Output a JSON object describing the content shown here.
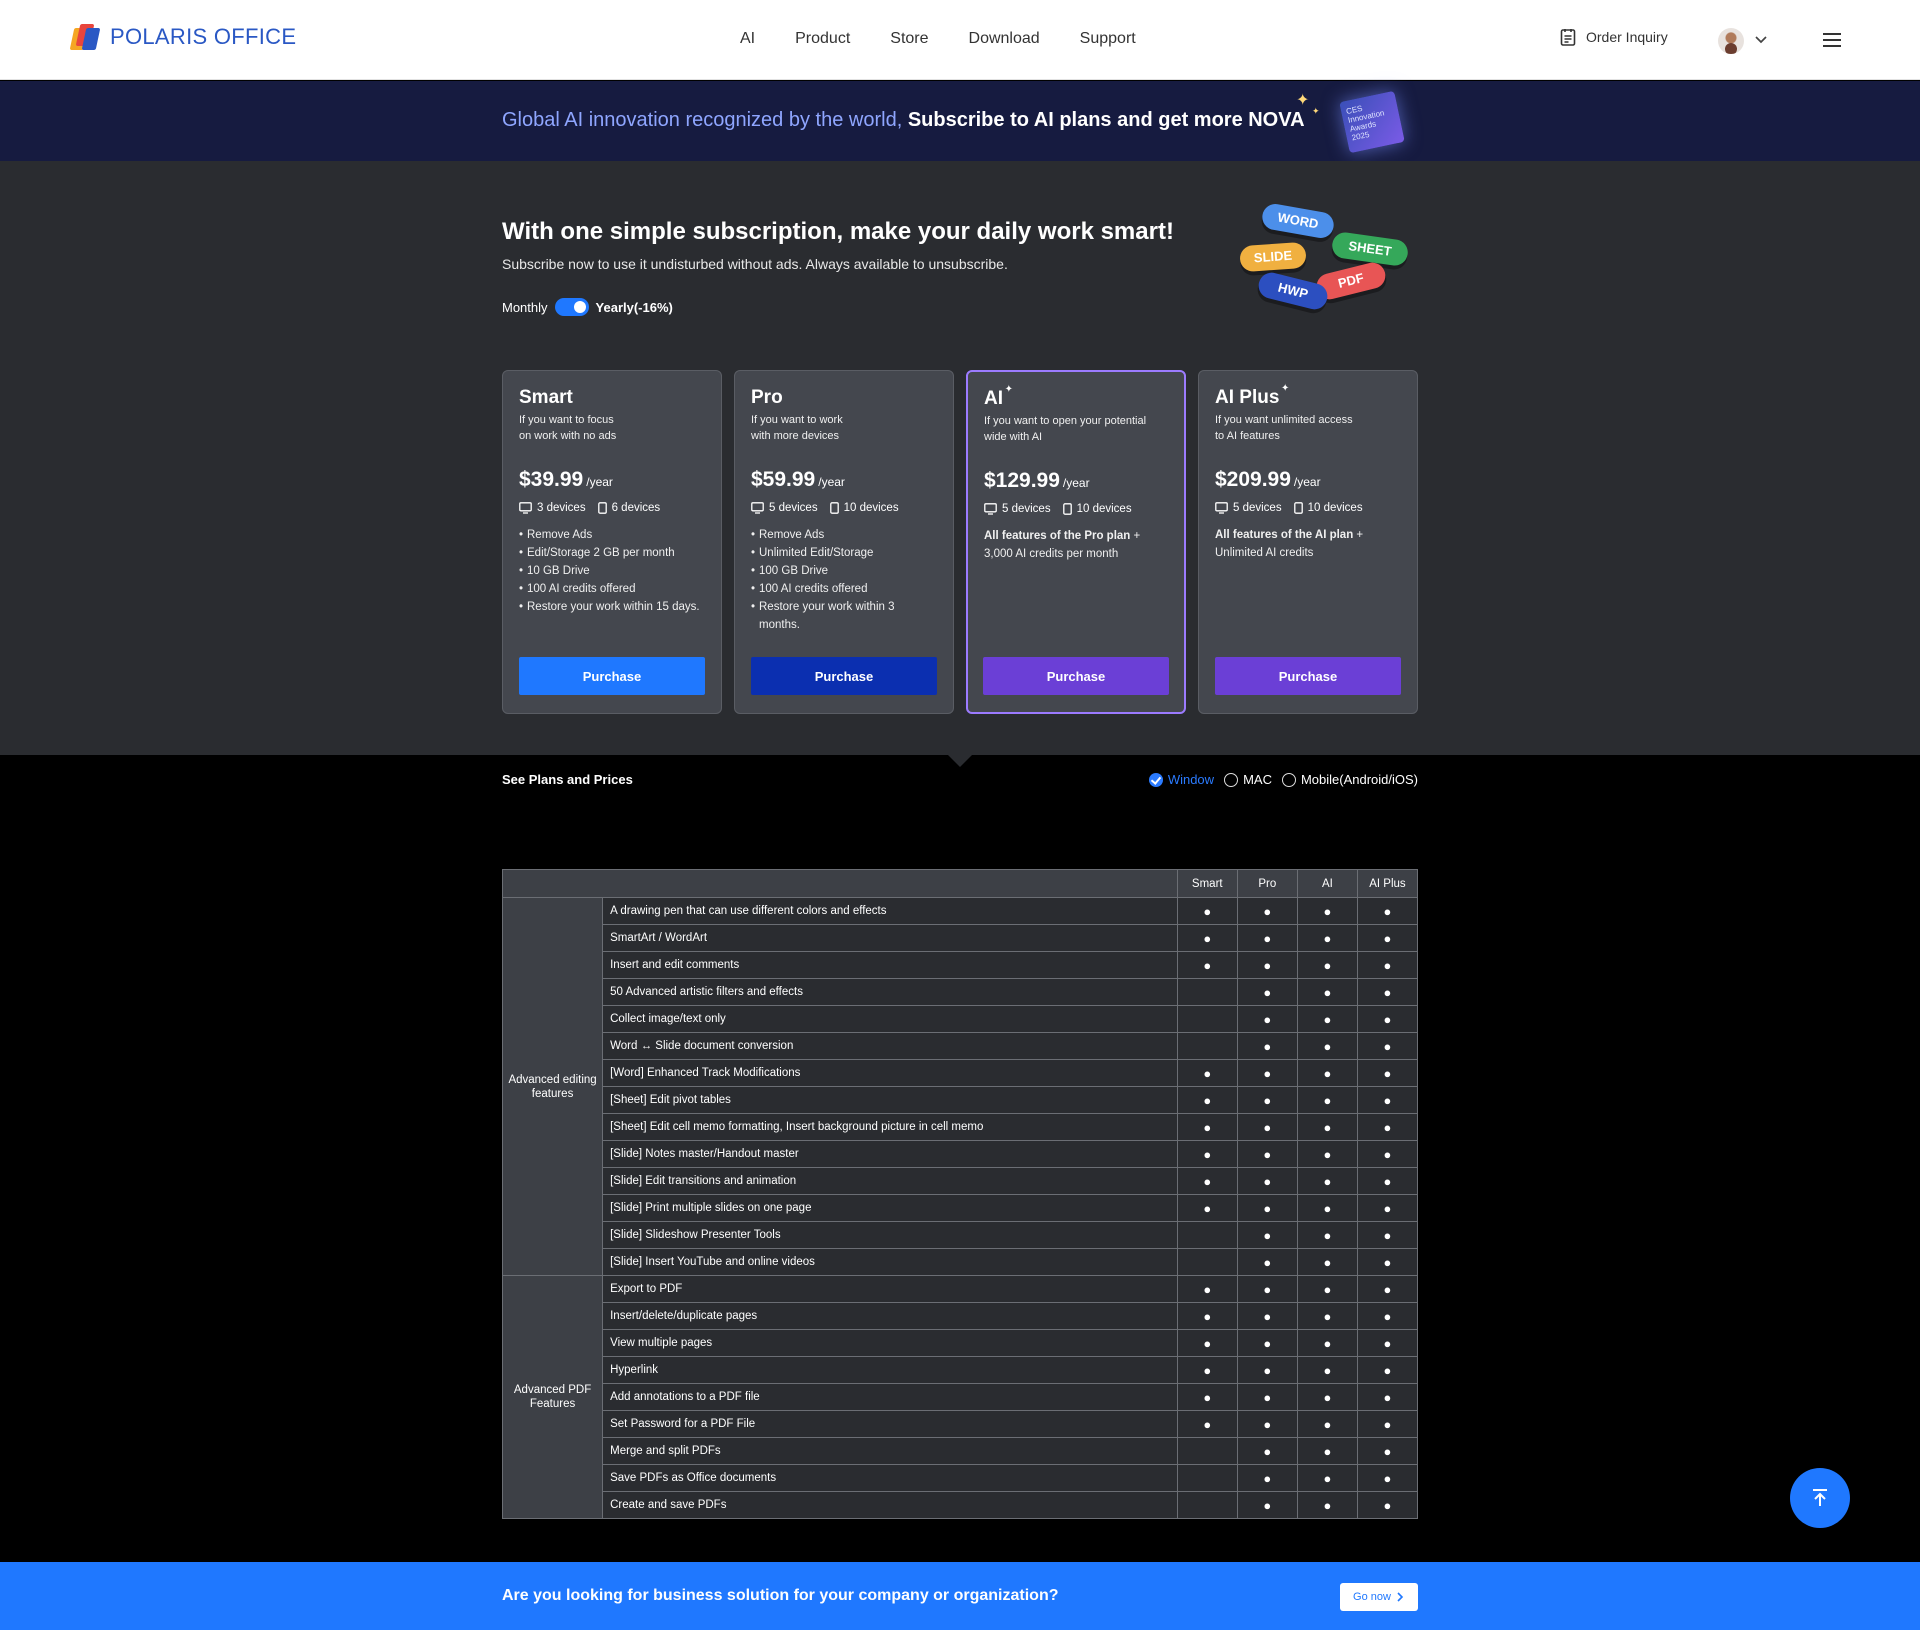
{
  "header": {
    "logo_text": "POLARIS OFFICE",
    "nav": [
      "AI",
      "Product",
      "Store",
      "Download",
      "Support"
    ],
    "order_inquiry": "Order Inquiry"
  },
  "banner": {
    "lite_text": "Global AI innovation recognized by the world,",
    "bold_text": "Subscribe to AI plans and get more NOVA",
    "badge_text": "CES Innovation Awards 2025"
  },
  "pricing": {
    "title": "With one simple subscription, make your daily work smart!",
    "subtitle": "Subscribe now to use it undisturbed without ads. Always available to unsubscribe.",
    "monthly": "Monthly",
    "yearly": "Yearly(-16%)",
    "pills": [
      "WORD",
      "SHEET",
      "SLIDE",
      "PDF",
      "HWP"
    ],
    "plans": [
      {
        "name": "Smart",
        "desc": "If you want to focus\non work with no ads",
        "price": "$39.99",
        "unit": "/year",
        "pc_devices": "3 devices",
        "mobile_devices": "6 devices",
        "features": [
          "Remove Ads",
          "Edit/Storage 2 GB per month",
          "10 GB Drive",
          "100 AI credits offered",
          "Restore your work within 15 days."
        ],
        "button": "Purchase",
        "button_color": "#1f78ff"
      },
      {
        "name": "Pro",
        "desc": "If you want to work\nwith more devices",
        "price": "$59.99",
        "unit": "/year",
        "pc_devices": "5 devices",
        "mobile_devices": "10 devices",
        "features": [
          "Remove Ads",
          "Unlimited Edit/Storage",
          "100 GB Drive",
          "100 AI credits offered",
          "Restore your work within 3 months."
        ],
        "button": "Purchase",
        "button_color": "#0b2fb0"
      },
      {
        "name": "AI",
        "desc": "If you want to open your potential\nwide with AI",
        "price": "$129.99",
        "unit": "/year",
        "pc_devices": "5 devices",
        "mobile_devices": "10 devices",
        "bold_feature": "All features of the Pro plan",
        "plus": " +",
        "extra": "3,000 AI credits per month",
        "button": "Purchase",
        "button_color": "#6b3fd6"
      },
      {
        "name": "AI Plus",
        "desc": "If you want unlimited access\nto AI features",
        "price": "$209.99",
        "unit": "/year",
        "pc_devices": "5 devices",
        "mobile_devices": "10 devices",
        "bold_feature": "All features of the AI plan",
        "plus": " +",
        "extra": "Unlimited AI credits",
        "button": "Purchase",
        "button_color": "#6b3fd6"
      }
    ]
  },
  "compare": {
    "see_plans": "See Plans and Prices",
    "os_options": [
      "Window",
      "MAC",
      "Mobile(Android/iOS)"
    ],
    "selected_os": "Window",
    "columns": [
      "Smart",
      "Pro",
      "AI",
      "AI Plus"
    ],
    "groups": [
      {
        "category": "Advanced editing features",
        "rows": [
          {
            "feature": "A drawing pen that can use different colors and effects",
            "marks": [
              true,
              true,
              true,
              true
            ]
          },
          {
            "feature": "SmartArt / WordArt",
            "marks": [
              true,
              true,
              true,
              true
            ]
          },
          {
            "feature": "Insert and edit comments",
            "marks": [
              true,
              true,
              true,
              true
            ]
          },
          {
            "feature": "50 Advanced artistic filters and effects",
            "marks": [
              false,
              true,
              true,
              true
            ]
          },
          {
            "feature": "Collect image/text only",
            "marks": [
              false,
              true,
              true,
              true
            ]
          },
          {
            "feature": "Word ↔ Slide document conversion",
            "marks": [
              false,
              true,
              true,
              true
            ]
          },
          {
            "feature": "[Word] Enhanced Track Modifications",
            "marks": [
              true,
              true,
              true,
              true
            ]
          },
          {
            "feature": "[Sheet] Edit pivot tables",
            "marks": [
              true,
              true,
              true,
              true
            ]
          },
          {
            "feature": "[Sheet] Edit cell memo formatting, Insert background picture in cell memo",
            "marks": [
              true,
              true,
              true,
              true
            ]
          },
          {
            "feature": "[Slide] Notes master/Handout master",
            "marks": [
              true,
              true,
              true,
              true
            ]
          },
          {
            "feature": "[Slide] Edit transitions and animation",
            "marks": [
              true,
              true,
              true,
              true
            ]
          },
          {
            "feature": "[Slide] Print multiple slides on one page",
            "marks": [
              true,
              true,
              true,
              true
            ]
          },
          {
            "feature": "[Slide] Slideshow Presenter Tools",
            "marks": [
              false,
              true,
              true,
              true
            ]
          },
          {
            "feature": "[Slide] Insert YouTube and online videos",
            "marks": [
              false,
              true,
              true,
              true
            ]
          }
        ]
      },
      {
        "category": "Advanced PDF Features",
        "rows": [
          {
            "feature": "Export to PDF",
            "marks": [
              true,
              true,
              true,
              true
            ]
          },
          {
            "feature": "Insert/delete/duplicate pages",
            "marks": [
              true,
              true,
              true,
              true
            ]
          },
          {
            "feature": "View multiple pages",
            "marks": [
              true,
              true,
              true,
              true
            ]
          },
          {
            "feature": "Hyperlink",
            "marks": [
              true,
              true,
              true,
              true
            ]
          },
          {
            "feature": "Add annotations to a PDF file",
            "marks": [
              true,
              true,
              true,
              true
            ]
          },
          {
            "feature": "Set Password for a PDF File",
            "marks": [
              true,
              true,
              true,
              true
            ]
          },
          {
            "feature": "Merge and split PDFs",
            "marks": [
              false,
              true,
              true,
              true
            ]
          },
          {
            "feature": "Save PDFs as Office documents",
            "marks": [
              false,
              true,
              true,
              true
            ]
          },
          {
            "feature": "Create and save PDFs",
            "marks": [
              false,
              true,
              true,
              true
            ]
          }
        ]
      }
    ],
    "mark_symbol": "●"
  },
  "business": {
    "text": "Are you looking for business solution for your company or organization?",
    "button": "Go now"
  },
  "colors": {
    "accent": "#1f78ff",
    "banner_bg": "#161b40",
    "pricing_bg": "#2a2c30",
    "ai_border": "#9c7bff"
  }
}
